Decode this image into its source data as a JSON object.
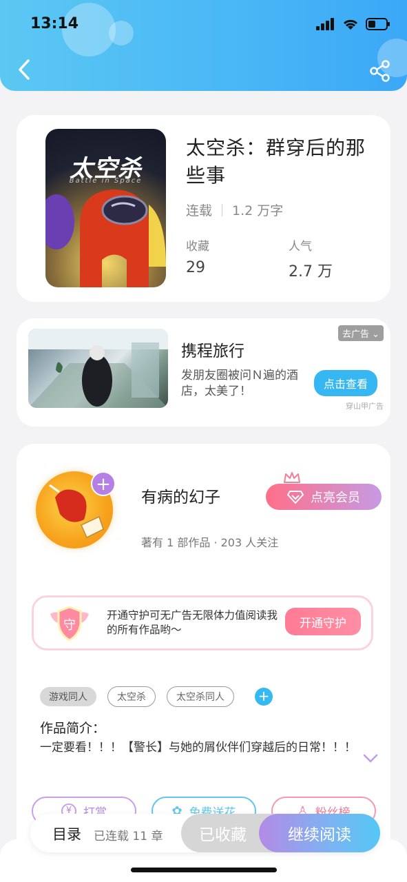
{
  "status_bar": {
    "time": "13:14"
  },
  "book": {
    "title": "太空杀：群穿后的那些事",
    "cover_title": "太空杀",
    "cover_subtitle": "Battle in Space",
    "status": "连载",
    "word_count": "1.2 万字",
    "stats": [
      {
        "label": "收藏",
        "value": "29"
      },
      {
        "label": "人气",
        "value": "2.7 万"
      }
    ]
  },
  "ad": {
    "title": "携程旅行",
    "description": "发朋友圈被问Ｎ遍的酒店，太美了！",
    "close_label": "去广告",
    "cta_label": "点击查看",
    "source": "穿山甲广告"
  },
  "author": {
    "name": "有病的幻子",
    "meta": "著有 1 部作品 · 203 人关注",
    "vip_label": "点亮会员",
    "guard_text": "开通守护可无广告无限体力值阅读我的所有作品哟～",
    "guard_icon_char": "守",
    "guard_button": "开通守护",
    "tags": [
      "游戏同人",
      "太空杀",
      "太空杀同人"
    ],
    "intro_label": "作品简介：",
    "intro_text": "一定要看！！！【警长】与她的屑伙伴们穿越后的日常！！！",
    "actions": [
      "打赏",
      "免费送花",
      "粉丝榜"
    ]
  },
  "bottom_bar": {
    "toc_label": "目录",
    "chapters": "已连载 11 章",
    "collected_label": "已收藏",
    "continue_label": "继续阅读"
  },
  "colors": {
    "header_gradient_start": "#5bc8f3",
    "accent_blue": "#36b8f0",
    "vip_pink": "#ff6f88",
    "guard_pink": "#ff7b95"
  }
}
